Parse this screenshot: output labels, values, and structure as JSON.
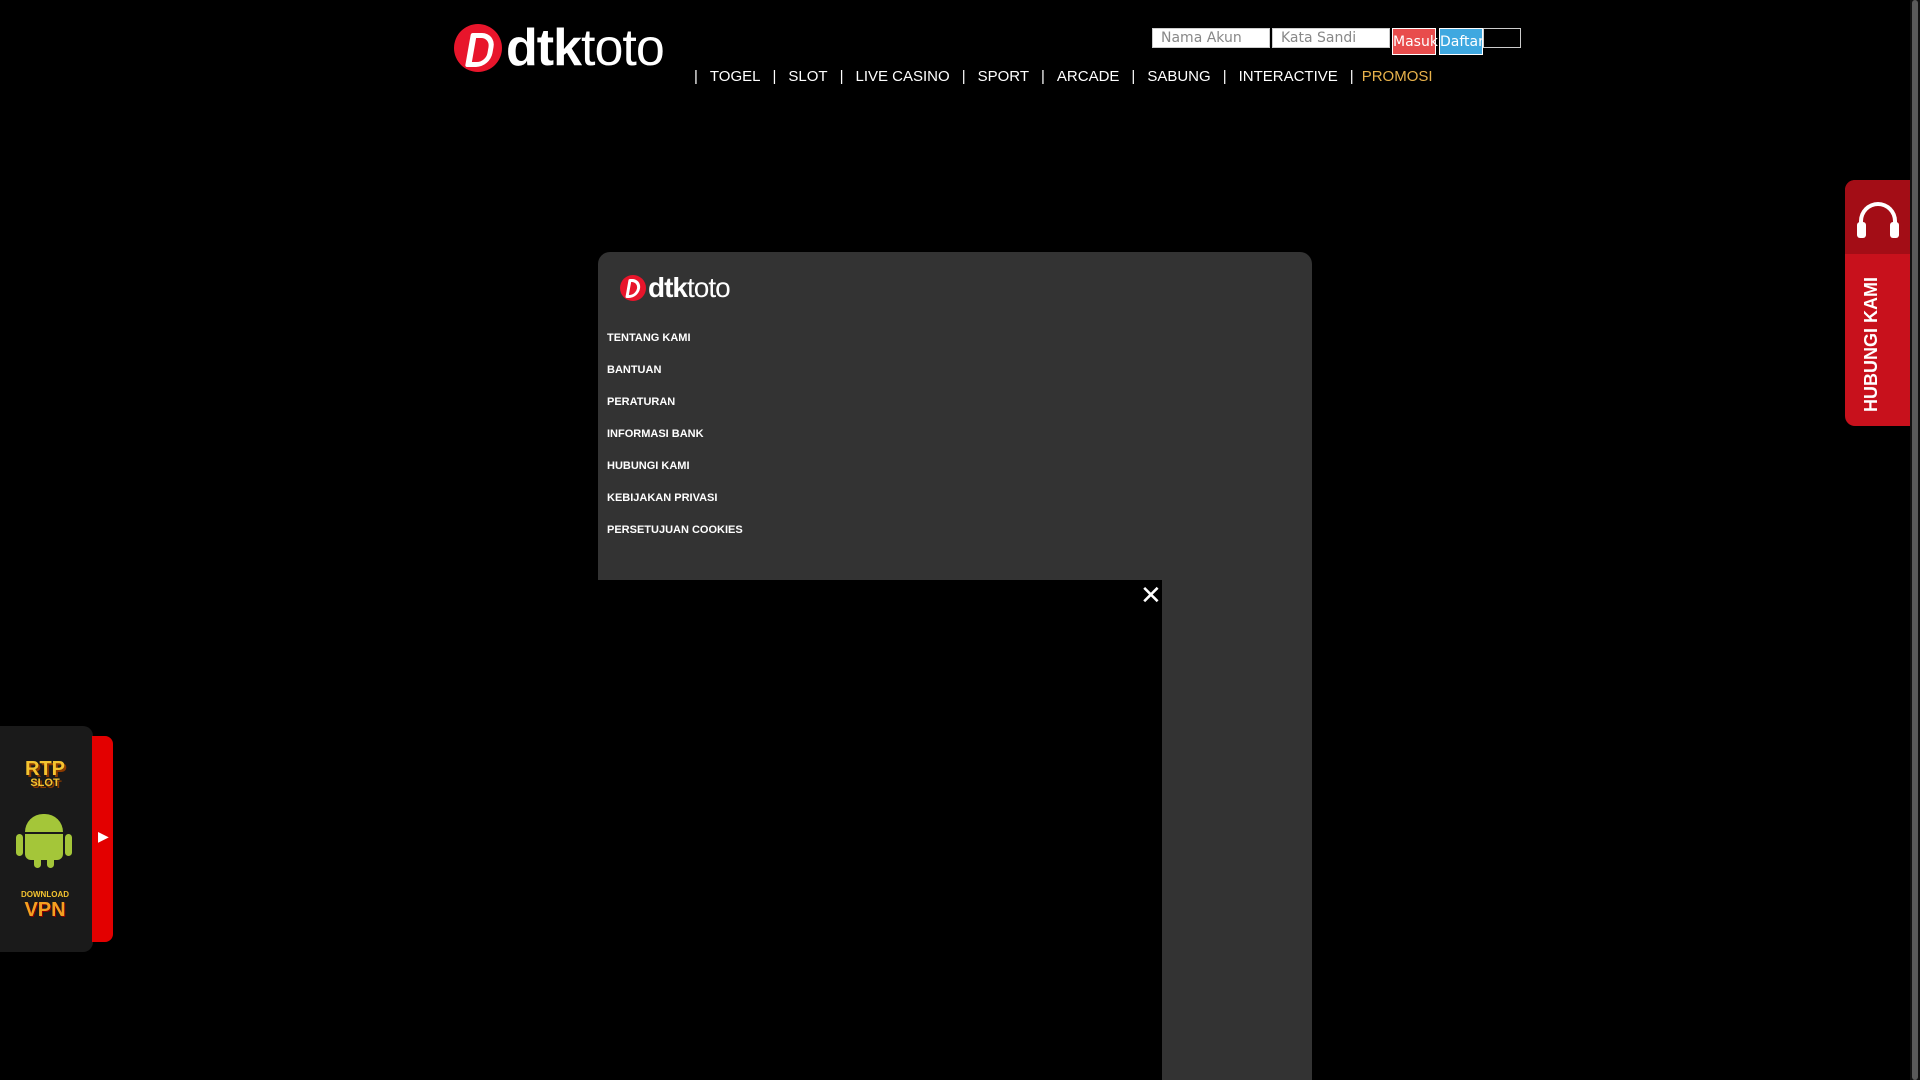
{
  "header": {
    "logo_bold": "dtk",
    "logo_light": "toto",
    "login": {
      "username_placeholder": "Nama Akun",
      "password_placeholder": "Kata Sandi",
      "login_label": "Masuk",
      "register_label": "Daftar"
    },
    "nav": {
      "home_icon": "",
      "items": [
        "TOGEL",
        "SLOT",
        "LIVE CASINO",
        "SPORT",
        "ARCADE",
        "SABUNG",
        "INTERACTIVE"
      ],
      "promo_label": "PROMOSI",
      "promo_icon": "",
      "separator": "|"
    }
  },
  "footer": {
    "logo_bold": "dtk",
    "logo_light": "toto",
    "links": [
      "TENTANG KAMI",
      "BANTUAN",
      "PERATURAN",
      "INFORMASI BANK",
      "HUBUNGI KAMI",
      "KEBIJAKAN PRIVASI",
      "PERSETUJUAN COOKIES"
    ],
    "close_glyph": "✕"
  },
  "contact": {
    "label": "HUBUNGI KAMI",
    "icon": "headset-icon"
  },
  "float_panel": {
    "rtp_main": "RTP",
    "rtp_sub": "SLOT",
    "vpn_top": "DOWNLOAD",
    "vpn_main": "VPN",
    "toggle_glyph": "▶"
  },
  "colors": {
    "brand_red": "#e8152b",
    "login_button": "#e84c4c",
    "register_button": "#3fa8e0",
    "promo_text": "#e8b24b",
    "card_bg": "#333333"
  }
}
